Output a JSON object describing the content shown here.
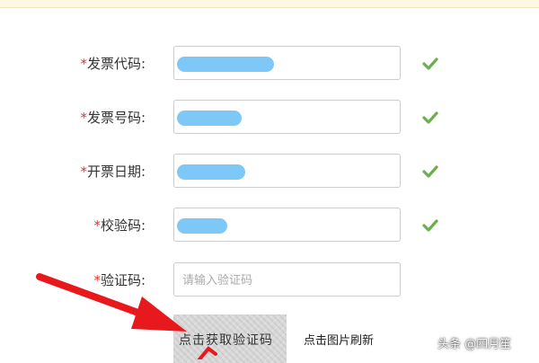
{
  "form": {
    "required_mark": "*",
    "fields": [
      {
        "label": "发票代码:",
        "status": "valid",
        "value_redacted": true
      },
      {
        "label": "发票号码:",
        "status": "valid",
        "value_redacted": true
      },
      {
        "label": "开票日期:",
        "status": "valid",
        "value_redacted": true
      },
      {
        "label": "校验码:",
        "status": "valid",
        "value_redacted": true
      },
      {
        "label": "验证码:",
        "placeholder": "请输入验证码",
        "value": ""
      }
    ],
    "captcha_text": "点击获取验证码",
    "refresh_link": "点击图片刷新"
  },
  "watermark": "头条 @四月笙",
  "colors": {
    "required": "#e0342c",
    "check": "#6ab04c",
    "redaction": "#7ec8f7",
    "annotation_arrow": "#e8191c"
  },
  "icons": [
    "check-icon",
    "annotation-arrow"
  ]
}
